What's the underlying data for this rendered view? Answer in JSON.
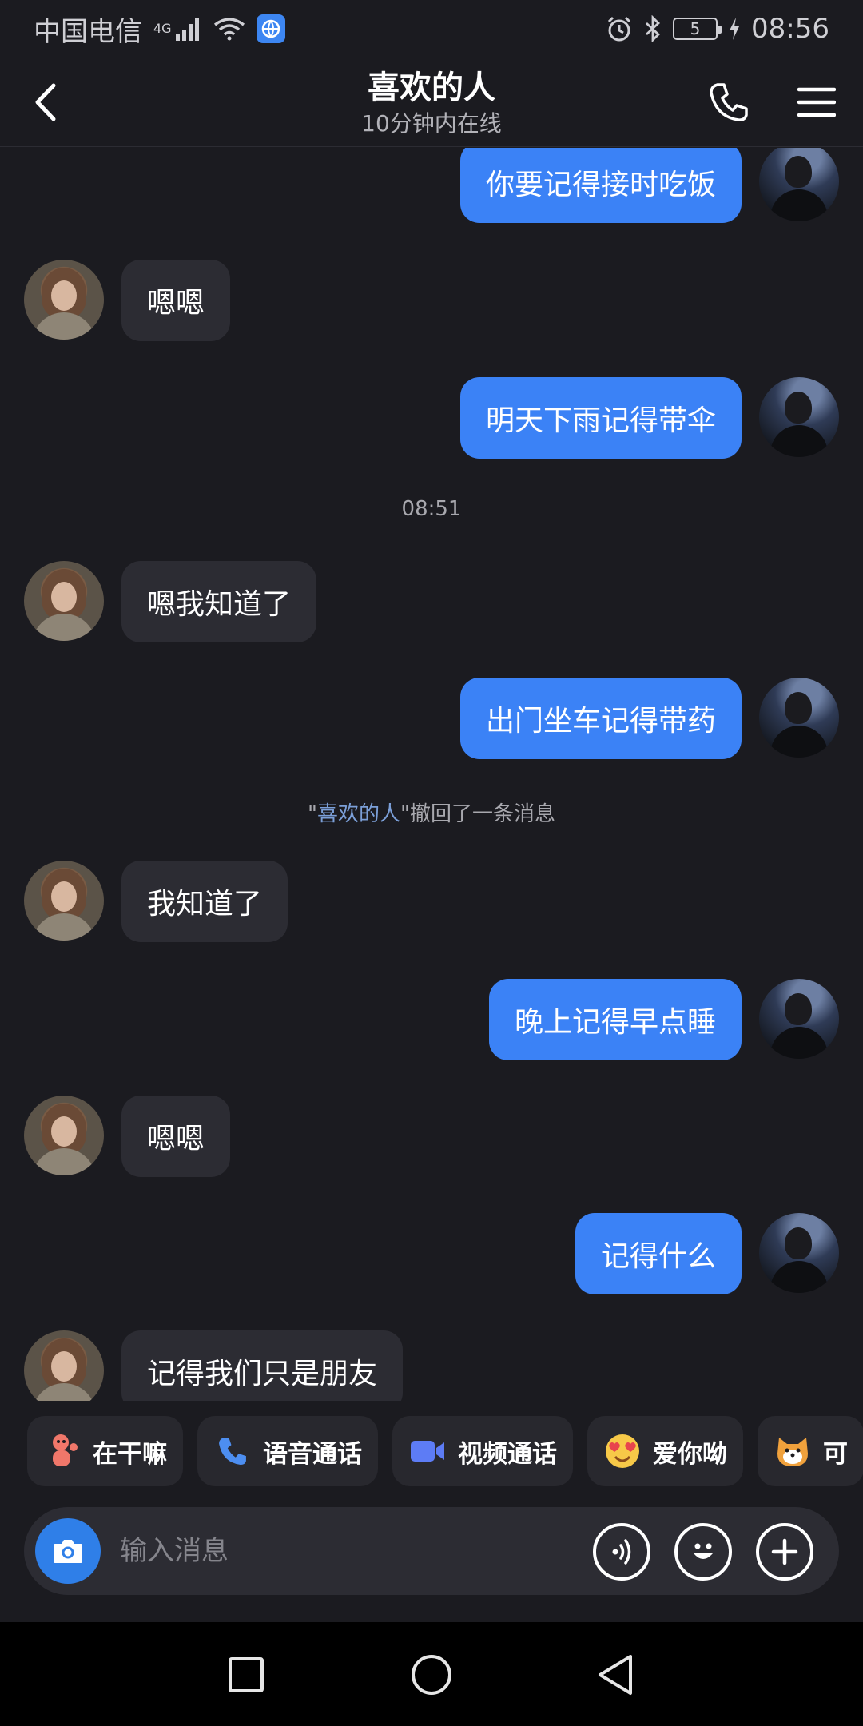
{
  "status_bar": {
    "carrier": "中国电信",
    "network": "4G",
    "time": "08:56",
    "battery": "5"
  },
  "header": {
    "title": "喜欢的人",
    "subtitle": "10分钟内在线"
  },
  "messages": [
    {
      "side": "right",
      "text": "你要记得接时吃饭"
    },
    {
      "side": "left",
      "text": "嗯嗯"
    },
    {
      "side": "right",
      "text": "明天下雨记得带伞"
    },
    {
      "type": "time",
      "text": "08:51"
    },
    {
      "side": "left",
      "text": "嗯我知道了"
    },
    {
      "side": "right",
      "text": "出门坐车记得带药"
    },
    {
      "type": "system",
      "quote_open": "\"",
      "name": "喜欢的人",
      "rest": "\"撤回了一条消息"
    },
    {
      "side": "left",
      "text": "我知道了"
    },
    {
      "side": "right",
      "text": "晚上记得早点睡"
    },
    {
      "side": "left",
      "text": "嗯嗯"
    },
    {
      "side": "right",
      "text": "记得什么"
    },
    {
      "side": "left",
      "text": "记得我们只是朋友"
    }
  ],
  "quick_actions": [
    {
      "label": "在干嘛",
      "icon": "waving-figure-icon"
    },
    {
      "label": "语音通话",
      "icon": "phone-icon"
    },
    {
      "label": "视频通话",
      "icon": "video-camera-icon"
    },
    {
      "label": "爱你呦",
      "icon": "heart-eyes-emoji-icon"
    },
    {
      "label": "可",
      "icon": "dog-emoji-icon"
    }
  ],
  "input": {
    "placeholder": "输入消息"
  },
  "colors": {
    "background": "#1b1b20",
    "bubble_self": "#3b82f6",
    "bubble_other": "#2c2c33",
    "accent_name": "#7b9fd8"
  }
}
